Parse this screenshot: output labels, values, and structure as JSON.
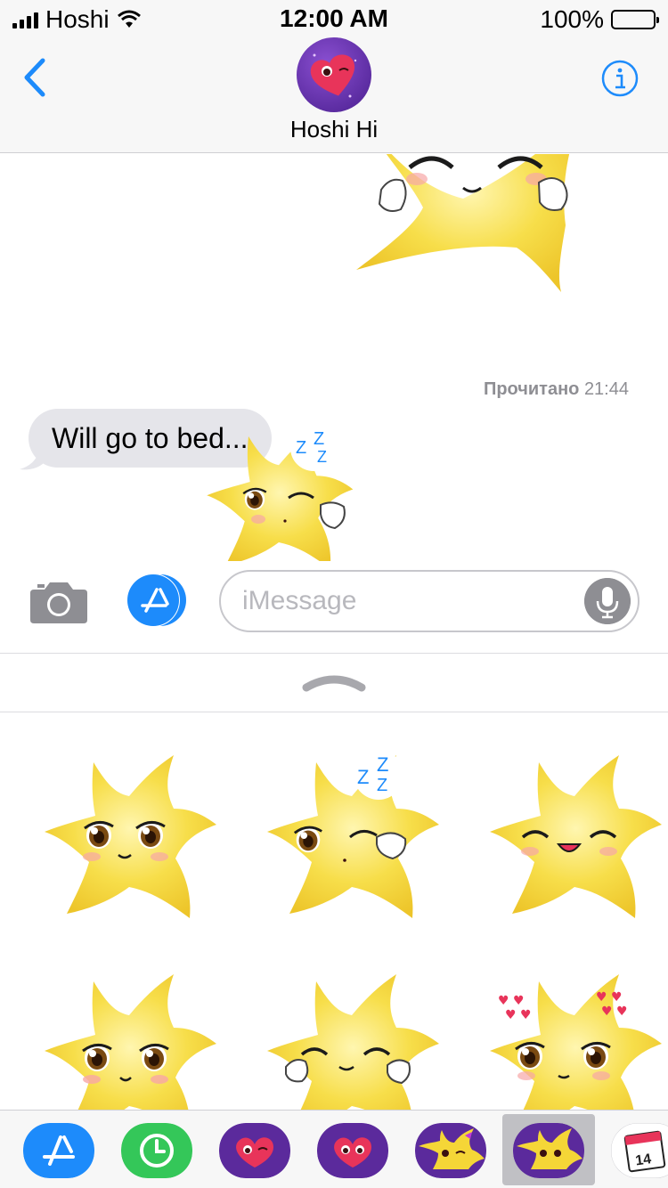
{
  "status_bar": {
    "carrier": "Hoshi",
    "time": "12:00 AM",
    "battery": "100%"
  },
  "header": {
    "contact_name": "Hoshi Hi",
    "back_icon": "chevron-left-icon",
    "info_icon": "info-icon"
  },
  "conversation": {
    "read_status": "Прочитано",
    "read_time": "21:44",
    "incoming_message": "Will go to bed..."
  },
  "composer": {
    "placeholder": "iMessage",
    "camera_icon": "camera-icon",
    "apps_icon": "app-store-icon",
    "mic_icon": "microphone-icon"
  },
  "drawer": {
    "handle_icon": "chevron-up-icon"
  },
  "stickers": [
    {
      "name": "star-big-eyes"
    },
    {
      "name": "star-sleepy-zzz"
    },
    {
      "name": "star-laughing"
    },
    {
      "name": "star-teary-eyes"
    },
    {
      "name": "star-happy-hands"
    },
    {
      "name": "star-hearts"
    }
  ],
  "tray": [
    {
      "name": "app-store-icon"
    },
    {
      "name": "recents-clock-icon"
    },
    {
      "name": "heart-wink-icon"
    },
    {
      "name": "heart-cry-icon"
    },
    {
      "name": "star-wink-icon"
    },
    {
      "name": "star-selected-icon"
    },
    {
      "name": "calendar-icon",
      "label": "14"
    }
  ],
  "colors": {
    "ios_blue": "#1d8bfb",
    "bubble_gray": "#e5e5ea",
    "star_yellow": "#f5d637",
    "tray_green": "#34c759",
    "purple": "#5b2a9c"
  }
}
